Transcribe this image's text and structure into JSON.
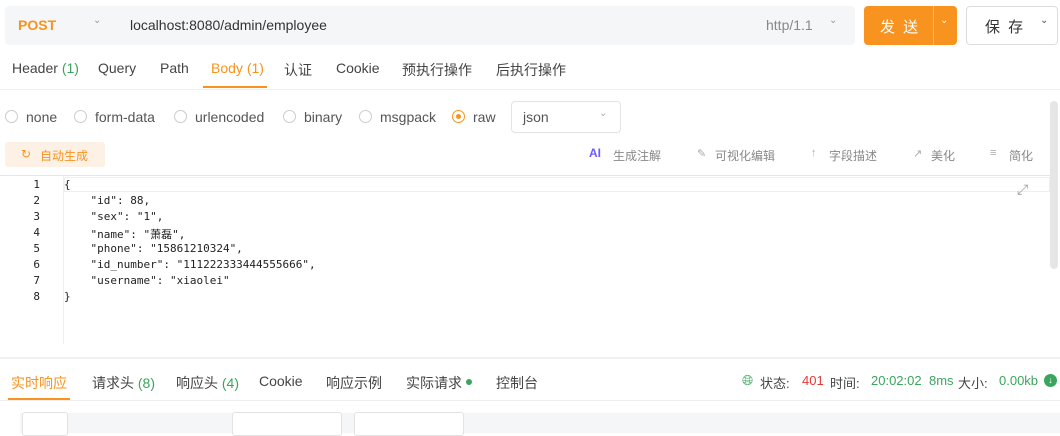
{
  "request": {
    "method": "POST",
    "url": "localhost:8080/admin/employee",
    "http_version": "http/1.1",
    "send_label": "发 送",
    "save_label": "保 存"
  },
  "tabs": [
    {
      "label": "Header",
      "count": "(1)"
    },
    {
      "label": "Query"
    },
    {
      "label": "Path"
    },
    {
      "label": "Body",
      "count": "(1)",
      "active": true
    },
    {
      "label": "认证"
    },
    {
      "label": "Cookie"
    },
    {
      "label": "预执行操作"
    },
    {
      "label": "后执行操作"
    }
  ],
  "body_types": [
    {
      "label": "none"
    },
    {
      "label": "form-data"
    },
    {
      "label": "urlencoded"
    },
    {
      "label": "binary"
    },
    {
      "label": "msgpack"
    },
    {
      "label": "raw",
      "selected": true
    }
  ],
  "format_select": "json",
  "toolbar": {
    "auto_generate": "自动生成",
    "ai_badge": "AI",
    "generate_comments": "生成注解",
    "visual_edit": "可视化编辑",
    "field_desc": "字段描述",
    "beautify": "美化",
    "simplify": "简化"
  },
  "editor": {
    "line_numbers": [
      "1",
      "2",
      "3",
      "4",
      "5",
      "6",
      "7",
      "8"
    ],
    "lines": [
      "{",
      "    \"id\": 88,",
      "    \"sex\": \"1\",",
      "    \"name\": \"萧磊\",",
      "    \"phone\": \"15861210324\",",
      "    \"id_number\": \"111222333444555666\",",
      "    \"username\": \"xiaolei\"",
      "}"
    ]
  },
  "response_tabs": [
    {
      "label": "实时响应",
      "active": true
    },
    {
      "label": "请求头",
      "count": "(8)"
    },
    {
      "label": "响应头",
      "count": "(4)"
    },
    {
      "label": "Cookie"
    },
    {
      "label": "响应示例"
    },
    {
      "label": "实际请求"
    },
    {
      "label": "控制台"
    }
  ],
  "status": {
    "status_label": "状态:",
    "status_code": "401",
    "time_label": "时间:",
    "time_value": "20:02:02",
    "duration": "8ms",
    "size_label": "大小:",
    "size_value": "0.00kb"
  },
  "colors": {
    "accent": "#f7931e",
    "green": "#3aa55d",
    "error": "#e53935"
  }
}
